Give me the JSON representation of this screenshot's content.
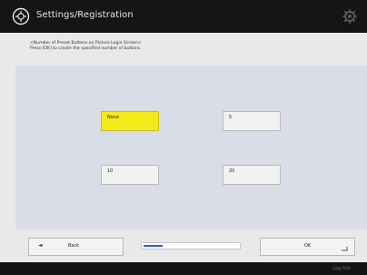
{
  "header": {
    "title": "Settings/Registration",
    "title_icon": "settings-registration-icon",
    "right_icon": "gear-icon"
  },
  "instructions": {
    "line1": "<Number of Preset Buttons on Picture Login Screen>",
    "line2": "Press [OK] to create the specified number of buttons."
  },
  "options": [
    {
      "label": "None",
      "selected": true
    },
    {
      "label": "5",
      "selected": false
    },
    {
      "label": "10",
      "selected": false
    },
    {
      "label": "20",
      "selected": false
    }
  ],
  "footer_buttons": {
    "back_label": "Back",
    "back_icon": "left-arrow-icon",
    "ok_label": "OK",
    "ok_icon": "ok-corner-mark-icon"
  },
  "progress": {
    "fraction": 0.2
  },
  "footer": {
    "logout_label": "Log Out"
  },
  "colors": {
    "selected": "#f3ea19",
    "panel": "#d9dde7",
    "progress": "#2d5fd8"
  }
}
